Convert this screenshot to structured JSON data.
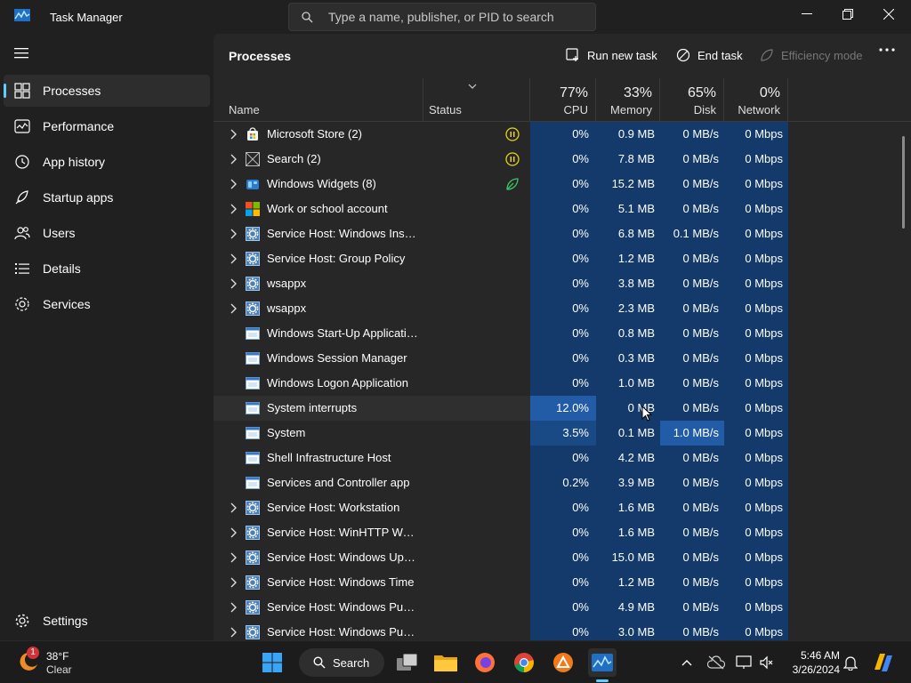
{
  "window": {
    "title": "Task Manager"
  },
  "search": {
    "placeholder": "Type a name, publisher, or PID to search"
  },
  "nav": {
    "items": [
      {
        "label": "Processes",
        "icon": "grid-icon"
      },
      {
        "label": "Performance",
        "icon": "performance-icon"
      },
      {
        "label": "App history",
        "icon": "history-icon"
      },
      {
        "label": "Startup apps",
        "icon": "startup-icon"
      },
      {
        "label": "Users",
        "icon": "users-icon"
      },
      {
        "label": "Details",
        "icon": "details-icon"
      },
      {
        "label": "Services",
        "icon": "services-icon"
      }
    ],
    "settings": "Settings"
  },
  "toolbar": {
    "title": "Processes",
    "run_new_task": "Run new task",
    "end_task": "End task",
    "efficiency_mode": "Efficiency mode"
  },
  "columns": {
    "name": "Name",
    "status": "Status",
    "cpu": {
      "label": "CPU",
      "pct": "77%"
    },
    "memory": {
      "label": "Memory",
      "pct": "33%"
    },
    "disk": {
      "label": "Disk",
      "pct": "65%"
    },
    "network": {
      "label": "Network",
      "pct": "0%"
    }
  },
  "processes": [
    {
      "name": "Microsoft Store (2)",
      "expand": true,
      "icon": "store",
      "status_icon": "pause",
      "cpu": "0%",
      "mem": "0.9 MB",
      "disk": "0 MB/s",
      "net": "0 Mbps"
    },
    {
      "name": "Search (2)",
      "expand": true,
      "icon": "blank",
      "status_icon": "pause",
      "cpu": "0%",
      "mem": "7.8 MB",
      "disk": "0 MB/s",
      "net": "0 Mbps"
    },
    {
      "name": "Windows Widgets (8)",
      "expand": true,
      "icon": "widgets",
      "status_icon": "leaf",
      "cpu": "0%",
      "mem": "15.2 MB",
      "disk": "0 MB/s",
      "net": "0 Mbps"
    },
    {
      "name": "Work or school account",
      "expand": true,
      "icon": "msft",
      "status_icon": "",
      "cpu": "0%",
      "mem": "5.1 MB",
      "disk": "0 MB/s",
      "net": "0 Mbps"
    },
    {
      "name": "Service Host: Windows Insider...",
      "expand": true,
      "icon": "gear",
      "status_icon": "",
      "cpu": "0%",
      "mem": "6.8 MB",
      "disk": "0.1 MB/s",
      "net": "0 Mbps"
    },
    {
      "name": "Service Host: Group Policy",
      "expand": true,
      "icon": "gear",
      "status_icon": "",
      "cpu": "0%",
      "mem": "1.2 MB",
      "disk": "0 MB/s",
      "net": "0 Mbps"
    },
    {
      "name": "wsappx",
      "expand": true,
      "icon": "gear",
      "status_icon": "",
      "cpu": "0%",
      "mem": "3.8 MB",
      "disk": "0 MB/s",
      "net": "0 Mbps"
    },
    {
      "name": "wsappx",
      "expand": true,
      "icon": "gear",
      "status_icon": "",
      "cpu": "0%",
      "mem": "2.3 MB",
      "disk": "0 MB/s",
      "net": "0 Mbps"
    },
    {
      "name": "Windows Start-Up Application",
      "expand": false,
      "icon": "window",
      "status_icon": "",
      "cpu": "0%",
      "mem": "0.8 MB",
      "disk": "0 MB/s",
      "net": "0 Mbps"
    },
    {
      "name": "Windows Session Manager",
      "expand": false,
      "icon": "window",
      "status_icon": "",
      "cpu": "0%",
      "mem": "0.3 MB",
      "disk": "0 MB/s",
      "net": "0 Mbps"
    },
    {
      "name": "Windows Logon Application",
      "expand": false,
      "icon": "window",
      "status_icon": "",
      "cpu": "0%",
      "mem": "1.0 MB",
      "disk": "0 MB/s",
      "net": "0 Mbps"
    },
    {
      "name": "System interrupts",
      "expand": false,
      "icon": "window",
      "status_icon": "",
      "cpu": "12.0%",
      "mem": "0 MB",
      "disk": "0 MB/s",
      "net": "0 Mbps",
      "cpu_hl": "hl3",
      "hover": true
    },
    {
      "name": "System",
      "expand": false,
      "icon": "window",
      "status_icon": "",
      "cpu": "3.5%",
      "mem": "0.1 MB",
      "disk": "1.0 MB/s",
      "net": "0 Mbps",
      "cpu_hl": "hl2",
      "disk_hl": "hl3"
    },
    {
      "name": "Shell Infrastructure Host",
      "expand": false,
      "icon": "window",
      "status_icon": "",
      "cpu": "0%",
      "mem": "4.2 MB",
      "disk": "0 MB/s",
      "net": "0 Mbps"
    },
    {
      "name": "Services and Controller app",
      "expand": false,
      "icon": "window",
      "status_icon": "",
      "cpu": "0.2%",
      "mem": "3.9 MB",
      "disk": "0 MB/s",
      "net": "0 Mbps"
    },
    {
      "name": "Service Host: Workstation",
      "expand": true,
      "icon": "gear",
      "status_icon": "",
      "cpu": "0%",
      "mem": "1.6 MB",
      "disk": "0 MB/s",
      "net": "0 Mbps"
    },
    {
      "name": "Service Host: WinHTTP Web P...",
      "expand": true,
      "icon": "gear",
      "status_icon": "",
      "cpu": "0%",
      "mem": "1.6 MB",
      "disk": "0 MB/s",
      "net": "0 Mbps"
    },
    {
      "name": "Service Host: Windows Update",
      "expand": true,
      "icon": "gear",
      "status_icon": "",
      "cpu": "0%",
      "mem": "15.0 MB",
      "disk": "0 MB/s",
      "net": "0 Mbps"
    },
    {
      "name": "Service Host: Windows Time",
      "expand": true,
      "icon": "gear",
      "status_icon": "",
      "cpu": "0%",
      "mem": "1.2 MB",
      "disk": "0 MB/s",
      "net": "0 Mbps"
    },
    {
      "name": "Service Host: Windows Push ...",
      "expand": true,
      "icon": "gear",
      "status_icon": "",
      "cpu": "0%",
      "mem": "4.9 MB",
      "disk": "0 MB/s",
      "net": "0 Mbps"
    },
    {
      "name": "Service Host: Windows Push ...",
      "expand": true,
      "icon": "gear",
      "status_icon": "",
      "cpu": "0%",
      "mem": "3.0 MB",
      "disk": "0 MB/s",
      "net": "0 Mbps"
    }
  ],
  "taskbar": {
    "weather_temp": "38°F",
    "weather_desc": "Clear",
    "weather_badge": "1",
    "search_label": "Search",
    "time": "5:46 AM",
    "date": "3/26/2024"
  },
  "colors": {
    "accent": "#60cdff",
    "heat_low": "#133a6b",
    "heat_mid": "#1a4a86",
    "heat_high": "#225ca6"
  }
}
